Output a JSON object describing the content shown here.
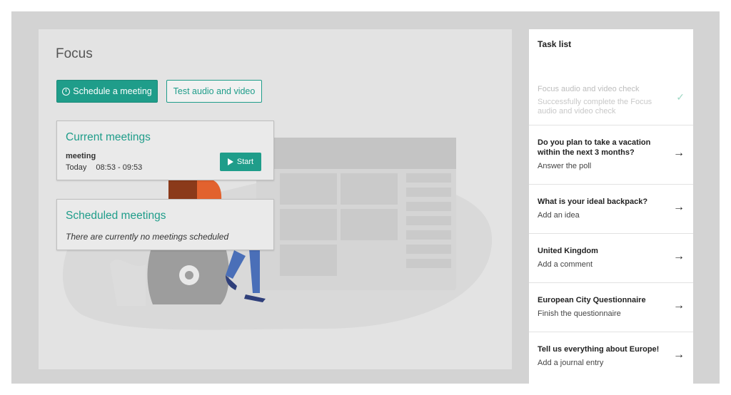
{
  "main": {
    "title": "Focus",
    "schedule_button": "Schedule a meeting",
    "test_av_button": "Test audio and video",
    "current_meetings": {
      "title": "Current meetings",
      "meeting_name": "meeting",
      "meeting_day": "Today",
      "meeting_time": "08:53 - 09:53",
      "start_button": "Start"
    },
    "scheduled_meetings": {
      "title": "Scheduled meetings",
      "empty_message": "There are currently no meetings scheduled"
    }
  },
  "tasks": {
    "header": "Task list",
    "items": [
      {
        "title": "Focus audio and video check",
        "subtitle": "Successfully complete the Focus audio and video check",
        "status": "completed",
        "icon": "check-icon"
      },
      {
        "title": "Do you plan to take a vacation within the next 3 months?",
        "subtitle": "Answer the poll",
        "status": "open",
        "icon": "arrow-right-icon"
      },
      {
        "title": "What is your ideal backpack?",
        "subtitle": "Add an idea",
        "status": "open",
        "icon": "arrow-right-icon"
      },
      {
        "title": "United Kingdom",
        "subtitle": "Add a comment",
        "status": "open",
        "icon": "arrow-right-icon"
      },
      {
        "title": "European City Questionnaire",
        "subtitle": "Finish the questionnaire",
        "status": "open",
        "icon": "arrow-right-icon"
      },
      {
        "title": "Tell us everything about Europe!",
        "subtitle": "Add a journal entry",
        "status": "open",
        "icon": "arrow-right-icon"
      }
    ]
  },
  "colors": {
    "accent": "#1f9d8a",
    "completed_check": "#9fd9c5"
  }
}
